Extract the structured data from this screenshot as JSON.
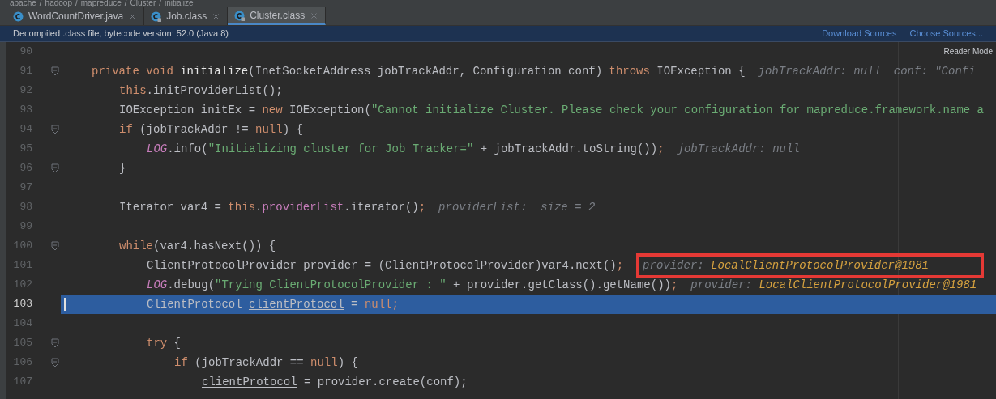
{
  "breadcrumb": {
    "items": [
      "apache",
      "hadoop",
      "mapreduce",
      "Cluster",
      "initialize"
    ],
    "separator": "/"
  },
  "tabs": [
    {
      "label": "WordCountDriver.java",
      "selected": false,
      "locked": false
    },
    {
      "label": "Job.class",
      "selected": false,
      "locked": true
    },
    {
      "label": "Cluster.class",
      "selected": true,
      "locked": true
    }
  ],
  "info_bar": {
    "message": "Decompiled .class file, bytecode version: 52.0 (Java 8)",
    "links": [
      "Download Sources",
      "Choose Sources..."
    ]
  },
  "reader_mode": "Reader Mode",
  "lines": [
    {
      "number": "90",
      "current": false,
      "fold": false
    },
    {
      "number": "91",
      "current": false,
      "fold": true,
      "tokens": [
        {
          "kind": "kw",
          "text": "private void "
        },
        {
          "kind": "decl",
          "text": "initialize"
        },
        {
          "kind": "plain",
          "text": "(InetSocketAddress jobTrackAddr, Configuration conf) "
        },
        {
          "kind": "kw",
          "text": "throws "
        },
        {
          "kind": "plain",
          "text": "IOException {"
        },
        {
          "kind": "hint",
          "label": "jobTrackAddr:",
          "value": "null",
          "object": false,
          "annotated": false
        },
        {
          "kind": "hint",
          "label": "conf:",
          "value": "\"Confi",
          "object": false,
          "annotated": false
        }
      ],
      "children": [
        {
          "number": "92",
          "current": false,
          "fold": false,
          "tokens": [
            {
              "kind": "kw",
              "text": "this"
            },
            {
              "kind": "plain",
              "text": ".initProviderList();"
            }
          ]
        },
        {
          "number": "93",
          "current": false,
          "fold": false,
          "tokens": [
            {
              "kind": "plain",
              "text": "IOException initEx = "
            },
            {
              "kind": "kw",
              "text": "new "
            },
            {
              "kind": "plain",
              "text": "IOException("
            },
            {
              "kind": "str",
              "text": "\"Cannot initialize Cluster. Please check your configuration for mapreduce.framework.name a"
            }
          ]
        },
        {
          "number": "94",
          "current": false,
          "fold": true,
          "tokens": [
            {
              "kind": "kw",
              "text": "if "
            },
            {
              "kind": "plain",
              "text": "(jobTrackAddr != "
            },
            {
              "kind": "kw",
              "text": "null"
            },
            {
              "kind": "plain",
              "text": ") {"
            }
          ],
          "children": [
            {
              "number": "95",
              "current": false,
              "fold": false,
              "tokens": [
                {
                  "kind": "static",
                  "text": "LOG"
                },
                {
                  "kind": "plain",
                  "text": ".info("
                },
                {
                  "kind": "str",
                  "text": "\"Initializing cluster for Job Tracker=\""
                },
                {
                  "kind": "plain",
                  "text": " + jobTrackAddr.toString())"
                },
                {
                  "kind": "kw",
                  "text": ";"
                },
                {
                  "kind": "hint",
                  "label": "jobTrackAddr:",
                  "value": "null",
                  "object": false,
                  "annotated": false
                }
              ]
            }
          ]
        },
        {
          "number": "96",
          "current": false,
          "fold": true,
          "tokens": [
            {
              "kind": "plain",
              "text": "}"
            }
          ]
        },
        {
          "number": "97",
          "current": false,
          "fold": false
        },
        {
          "number": "98",
          "current": false,
          "fold": false,
          "tokens": [
            {
              "kind": "plain",
              "text": "Iterator var4 = "
            },
            {
              "kind": "kw",
              "text": "this"
            },
            {
              "kind": "plain",
              "text": "."
            },
            {
              "kind": "field",
              "text": "providerList"
            },
            {
              "kind": "plain",
              "text": ".iterator()"
            },
            {
              "kind": "kw",
              "text": ";"
            },
            {
              "kind": "hint",
              "label": "providerList:",
              "value": " size = 2",
              "object": false,
              "annotated": false
            }
          ]
        },
        {
          "number": "99",
          "current": false,
          "fold": false
        },
        {
          "number": "100",
          "current": false,
          "fold": true,
          "tokens": [
            {
              "kind": "kw",
              "text": "while"
            },
            {
              "kind": "plain",
              "text": "(var4.hasNext()) {"
            }
          ],
          "children": [
            {
              "number": "101",
              "current": false,
              "fold": false,
              "tokens": [
                {
                  "kind": "plain",
                  "text": "ClientProtocolProvider provider = (ClientProtocolProvider)var4.next()"
                },
                {
                  "kind": "kw",
                  "text": ";"
                },
                {
                  "kind": "hint",
                  "label": "provider:",
                  "value": "LocalClientProtocolProvider@1981",
                  "object": true,
                  "annotated": true
                }
              ]
            },
            {
              "number": "102",
              "current": false,
              "fold": false,
              "tokens": [
                {
                  "kind": "static",
                  "text": "LOG"
                },
                {
                  "kind": "plain",
                  "text": ".debug("
                },
                {
                  "kind": "str",
                  "text": "\"Trying ClientProtocolProvider : \""
                },
                {
                  "kind": "plain",
                  "text": " + provider.getClass().getName())"
                },
                {
                  "kind": "kw",
                  "text": ";"
                },
                {
                  "kind": "hint",
                  "label": "provider:",
                  "value": "LocalClientProtocolProvider@1981",
                  "object": true,
                  "annotated": false
                }
              ]
            },
            {
              "number": "103",
              "current": true,
              "fold": false,
              "tokens": [
                {
                  "kind": "plain",
                  "text": "ClientProtocol "
                },
                {
                  "kind": "var",
                  "text": "clientProtocol"
                },
                {
                  "kind": "plain",
                  "text": " = "
                },
                {
                  "kind": "kw",
                  "text": "null;"
                }
              ]
            },
            {
              "number": "104",
              "current": false,
              "fold": false
            },
            {
              "number": "105",
              "current": false,
              "fold": true,
              "tokens": [
                {
                  "kind": "kw",
                  "text": "try "
                },
                {
                  "kind": "plain",
                  "text": "{"
                }
              ],
              "children": [
                {
                  "number": "106",
                  "current": false,
                  "fold": true,
                  "tokens": [
                    {
                      "kind": "kw",
                      "text": "if "
                    },
                    {
                      "kind": "plain",
                      "text": "(jobTrackAddr == "
                    },
                    {
                      "kind": "kw",
                      "text": "null"
                    },
                    {
                      "kind": "plain",
                      "text": ") {"
                    }
                  ],
                  "children": [
                    {
                      "number": "107",
                      "current": false,
                      "fold": false,
                      "tokens": [
                        {
                          "kind": "var",
                          "text": "clientProtocol"
                        },
                        {
                          "kind": "plain",
                          "text": " = provider.create(conf);"
                        }
                      ]
                    }
                  ]
                }
              ]
            }
          ]
        }
      ]
    }
  ]
}
